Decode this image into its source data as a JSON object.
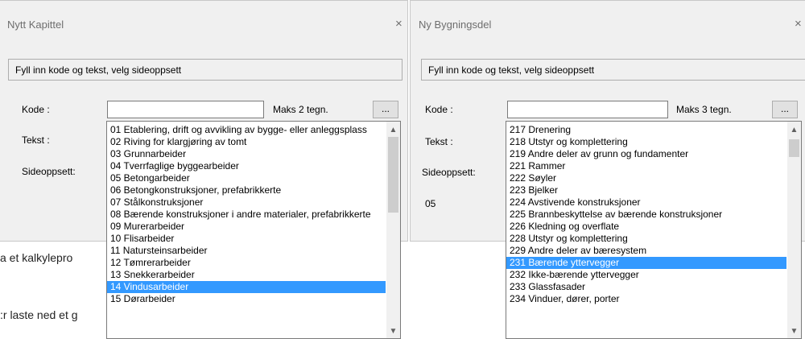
{
  "background": {
    "line1": "a et kalkylepro",
    "line2": ":r laste ned et g"
  },
  "dialog_left": {
    "title": "Nytt Kapittel",
    "close_icon": "×",
    "info": "Fyll inn kode og tekst, velg sideoppsett",
    "kode_label": "Kode :",
    "kode_value": "",
    "maks": "Maks 2 tegn.",
    "browse_label": "...",
    "tekst_label": "Tekst :",
    "sideoppsett_label": "Sideoppsett:",
    "list": [
      "01 Etablering, drift og avvikling av bygge- eller anleggsplass",
      "02 Riving for klargjøring av tomt",
      "03 Grunnarbeider",
      "04 Tverrfaglige byggearbeider",
      "05 Betongarbeider",
      "06 Betongkonstruksjoner, prefabrikkerte",
      "07 Stålkonstruksjoner",
      "08 Bærende konstruksjoner i andre materialer, prefabrikkerte",
      "09 Murerarbeider",
      "10 Flisarbeider",
      "11 Natursteinsarbeider",
      "12 Tømrerarbeider",
      "13 Snekkerarbeider",
      "14 Vindusarbeider",
      "15 Dørarbeider"
    ],
    "selected_index": 13
  },
  "dialog_right": {
    "title": "Ny Bygningsdel",
    "close_icon": "×",
    "info": "Fyll inn kode og tekst, velg sideoppsett",
    "kode_label": "Kode :",
    "kode_value": "",
    "maks": "Maks 3 tegn.",
    "browse_label": "...",
    "tekst_label": "Tekst :",
    "sideoppsett_label": "Sideoppsett:",
    "sideoppsett_value": "05",
    "list": [
      "217 Drenering",
      "218 Utstyr og komplettering",
      "219 Andre deler av grunn og fundamenter",
      "221 Rammer",
      "222 Søyler",
      "223 Bjelker",
      "224 Avstivende konstruksjoner",
      "225 Brannbeskyttelse av bærende konstruksjoner",
      "226 Kledning og overflate",
      "228 Utstyr og komplettering",
      "229 Andre deler av bæresystem",
      "231 Bærende yttervegger",
      "232 Ikke-bærende yttervegger",
      "233 Glassfasader",
      "234 Vinduer, dører, porter"
    ],
    "selected_index": 11
  },
  "icons": {
    "scroll_up": "chevron-up-icon",
    "scroll_down": "chevron-down-icon",
    "close": "close-icon"
  }
}
